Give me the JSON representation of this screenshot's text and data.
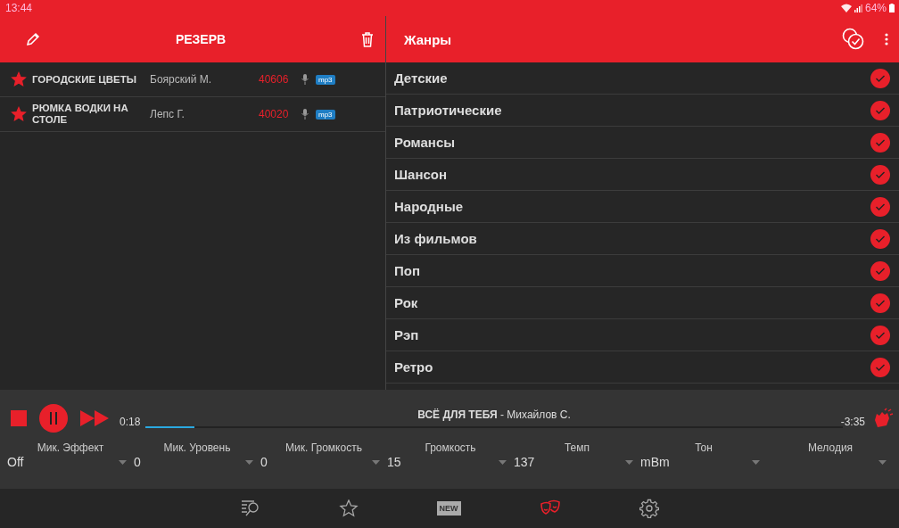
{
  "status_bar": {
    "time": "13:44",
    "battery": "64%"
  },
  "left_header": {
    "title": "РЕЗЕРВ"
  },
  "reserve": [
    {
      "title": "ГОРОДСКИЕ ЦВЕТЫ",
      "artist": "Боярский М.",
      "code": "40606",
      "format": "mp3",
      "favorite": true
    },
    {
      "title": "РЮМКА ВОДКИ НА СТОЛЕ",
      "artist": "Лепс Г.",
      "code": "40020",
      "format": "mp3",
      "favorite": true
    }
  ],
  "right_header": {
    "title": "Жанры"
  },
  "genres": [
    {
      "name": "Детские",
      "checked": true
    },
    {
      "name": "Патриотические",
      "checked": true
    },
    {
      "name": "Романсы",
      "checked": true
    },
    {
      "name": "Шансон",
      "checked": true
    },
    {
      "name": "Народные",
      "checked": true
    },
    {
      "name": "Из фильмов",
      "checked": true
    },
    {
      "name": "Поп",
      "checked": true
    },
    {
      "name": "Рок",
      "checked": true
    },
    {
      "name": "Рэп",
      "checked": true
    },
    {
      "name": "Ретро",
      "checked": true
    }
  ],
  "player": {
    "song": "**ВСЁ ДЛЯ ТЕБЯ** - Михайлов С.",
    "playing": true,
    "elapsed": "0:18",
    "remaining": "-3:35",
    "level": 0.07
  },
  "controls": [
    {
      "label": "Мик. Эффект",
      "value": "Off"
    },
    {
      "label": "Мик. Уровень",
      "value": "0"
    },
    {
      "label": "Мик. Громкость",
      "value": "0"
    },
    {
      "label": "Громкость",
      "value": "15"
    },
    {
      "label": "Темп",
      "value": "137"
    },
    {
      "label": "Тон",
      "value": "mBm"
    },
    {
      "label": "Мелодия"
    }
  ],
  "bottom_nav": [
    {
      "kind": "search",
      "selected": false
    },
    {
      "kind": "star",
      "selected": false
    },
    {
      "kind": "new",
      "label": "NEW",
      "selected": false
    },
    {
      "kind": "masks",
      "selected": true
    },
    {
      "kind": "settings",
      "selected": false
    }
  ]
}
